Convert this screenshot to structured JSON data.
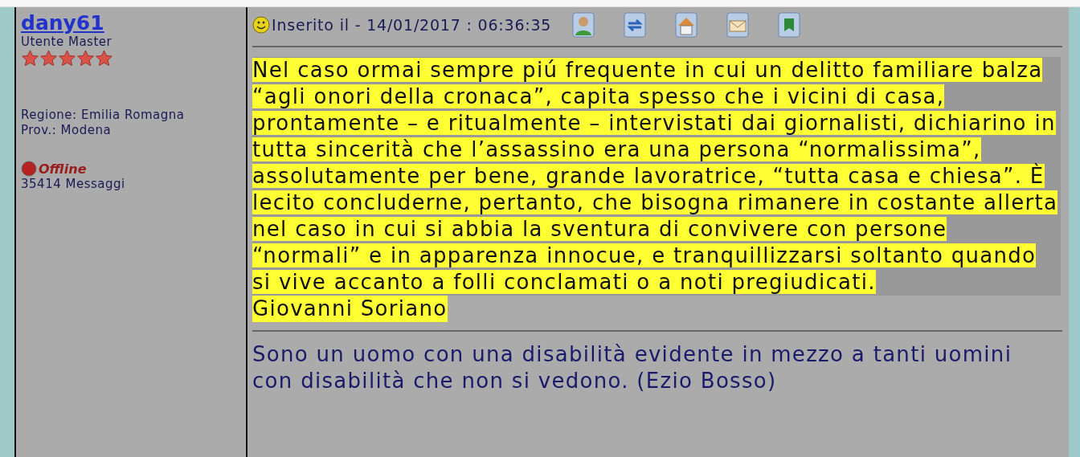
{
  "author": {
    "username": "dany61",
    "rank": "Utente Master",
    "stars": 5,
    "region": "Regione: Emilia Romagna",
    "province": "Prov.: Modena",
    "status": {
      "label": "Offline",
      "online": false
    },
    "posts": "35414 Messaggi"
  },
  "post": {
    "posted": "Inserito il - 14/01/2017 : 06:36:35",
    "toolbar": [
      {
        "kind": "profile"
      },
      {
        "kind": "quote"
      },
      {
        "kind": "home"
      },
      {
        "kind": "email"
      },
      {
        "kind": "bookmark"
      }
    ],
    "quote": "Nel caso ormai sempre piú frequente in cui un delitto familiare balza “agli onori della cronaca”, capita spesso che i vicini di casa, prontamente – e ritualmente – intervistati dai giornalisti, dichiarino in tutta sincerità che l’assassino era una persona “normalissima”, assolutamente per bene, grande lavoratrice, “tutta casa e chiesa”. È lecito concluderne, pertanto, che bisogna rimanere in costante allerta nel caso in cui si abbia la sventura di convivere con persone “normali” e in apparenza innocue, e tranquillizzarsi soltanto quando si vive accanto a folli conclamati o a noti pregiudicati.",
    "quote_author": "Giovanni Soriano",
    "signature": "Sono un uomo con una disabilità evidente in mezzo a tanti uomini con disabilità che non si vedono. (Ezio Bosso)"
  }
}
